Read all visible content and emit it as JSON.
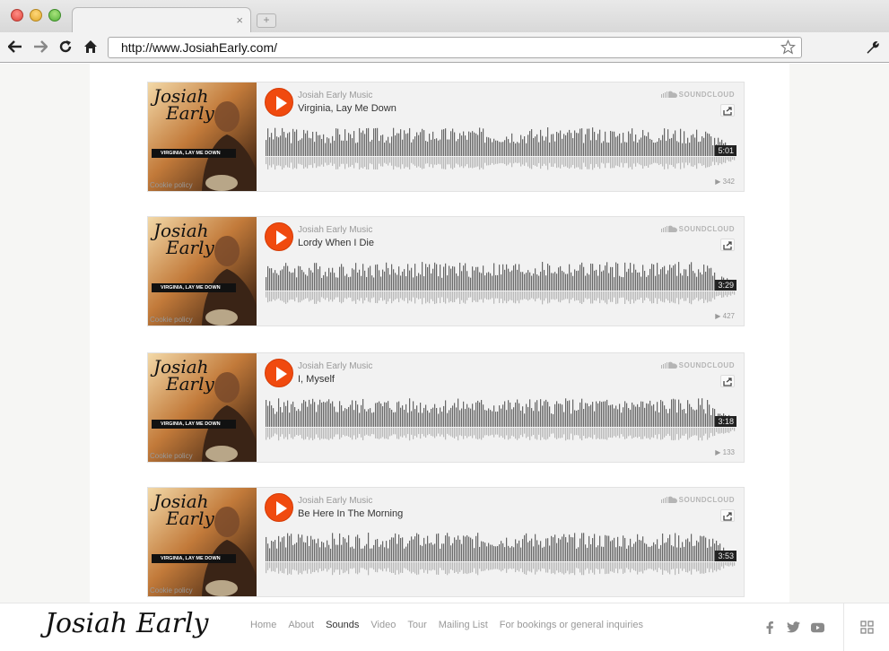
{
  "browser": {
    "tab_close": "×",
    "new_tab": "+",
    "url": "http://www.JosiahEarly.com/"
  },
  "album_art": {
    "name_line1": "Josiah",
    "name_line2": "Early",
    "banner": "VIRGINIA, LAY ME DOWN",
    "cookie": "Cookie policy"
  },
  "soundcloud_label": "SOUNDCLOUD",
  "tracks": [
    {
      "artist": "Josiah Early Music",
      "title": "Virginia, Lay Me Down",
      "duration": "5:01",
      "plays": "342"
    },
    {
      "artist": "Josiah Early Music",
      "title": "Lordy When I Die",
      "duration": "3:29",
      "plays": "427"
    },
    {
      "artist": "Josiah Early Music",
      "title": "I, Myself",
      "duration": "3:18",
      "plays": "133"
    },
    {
      "artist": "Josiah Early Music",
      "title": "Be Here In The Morning",
      "duration": "3:53",
      "plays": ""
    }
  ],
  "footer": {
    "brand": "Josiah Early",
    "nav": [
      "Home",
      "About",
      "Sounds",
      "Video",
      "Tour",
      "Mailing List",
      "For bookings or general inquiries"
    ],
    "active_nav": "Sounds"
  },
  "colors": {
    "play": "#f04a0f",
    "wave": "#666666",
    "wave_reflection": "#b8b8b8"
  }
}
